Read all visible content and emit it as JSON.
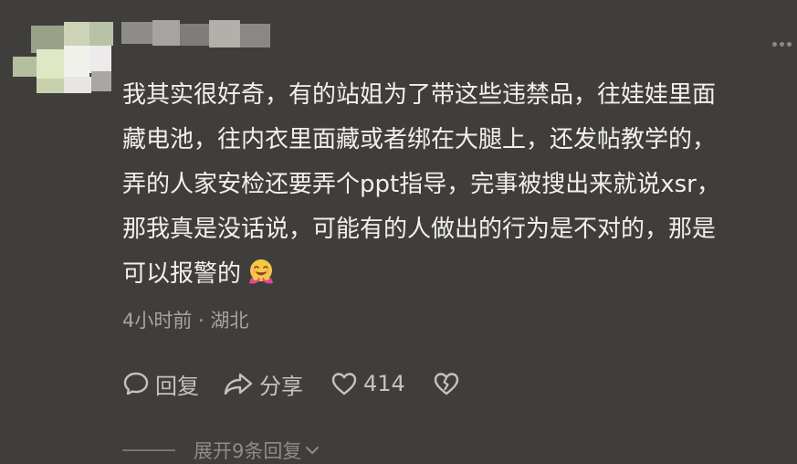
{
  "comment": {
    "lines": [
      "我其实很好奇，有的站姐为了带这些违禁品，往娃娃里面",
      "藏电池，往内衣里面藏或者绑在大腿上，还发帖教学的，",
      "弄的人家安检还要弄个ppt指导，完事被搜出来就说xsr，",
      "那我真是没话说，可能有的人做出的行为是不对的，那是",
      "可以报警的"
    ],
    "emoji": "hugging-face-icon",
    "meta": "4小时前 · 湖北"
  },
  "actions": {
    "reply_label": "回复",
    "share_label": "分享",
    "like_count": "414"
  },
  "expand": {
    "label": "展开9条回复"
  },
  "colors": {
    "background": "#3f3e3c",
    "text": "#f2f0ec",
    "meta_text": "#a7a49e",
    "action_text": "#c6c3bd",
    "avatar_tint": "#dfe7c5"
  },
  "icons": {
    "reply": "comment-bubble-icon",
    "share": "share-arrow-icon",
    "like": "heart-outline-icon",
    "dislike": "broken-heart-icon",
    "more": "more-dots-icon",
    "expand": "chevron-down-icon"
  }
}
